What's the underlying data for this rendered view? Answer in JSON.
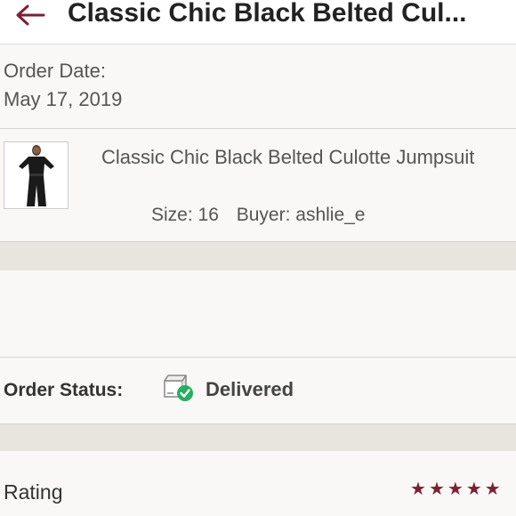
{
  "header": {
    "title": "Classic Chic Black Belted Cul..."
  },
  "order": {
    "date_label": "Order Date:",
    "date_value": "May 17, 2019"
  },
  "item": {
    "title": "Classic Chic Black Belted Culotte Jumpsuit",
    "size": "Size: 16",
    "buyer": "Buyer: ashlie_e"
  },
  "status": {
    "label": "Order Status:",
    "value": "Delivered",
    "icon": "package-delivered-icon"
  },
  "rating": {
    "label": "Rating",
    "stars": 5,
    "max": 5
  },
  "colors": {
    "accent": "#7b2035",
    "success": "#27ae60"
  }
}
